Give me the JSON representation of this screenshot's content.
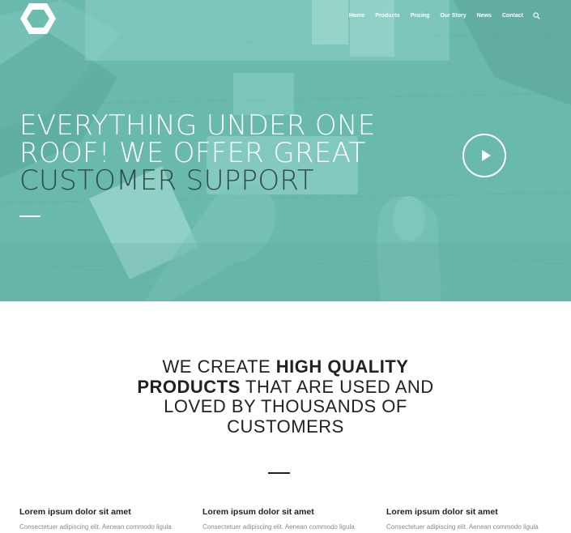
{
  "nav": {
    "items": [
      "Home",
      "Products",
      "Pricing",
      "Our Story",
      "News",
      "Contact"
    ],
    "search_icon": "search-icon"
  },
  "hero": {
    "headline_line1": "EVERYTHING UNDER ONE",
    "headline_line2": "ROOF! WE OFFER GREAT",
    "headline_line3": "CUSTOMER SUPPORT",
    "play_icon": "play-icon",
    "overlay_color": "#6cbcb0",
    "dark_text_color": "#2f4a47"
  },
  "tagline": {
    "line1_pre": "WE CREATE ",
    "line1_bold": "HIGH QUALITY",
    "line2_bold": "PRODUCTS",
    "line2_post": " THAT ARE USED AND",
    "line3": "LOVED BY THOUSANDS OF",
    "line4": "CUSTOMERS"
  },
  "features": [
    {
      "title": "Lorem ipsum dolor sit amet",
      "text": "Consectetuer adipiscing elit. Aenean commodo ligula"
    },
    {
      "title": "Lorem ipsum dolor sit amet",
      "text": "Consectetuer adipiscing elit. Aenean commodo ligula"
    },
    {
      "title": "Lorem ipsum dolor sit amet",
      "text": "Consectetuer adipiscing elit. Aenean commodo ligula"
    }
  ]
}
